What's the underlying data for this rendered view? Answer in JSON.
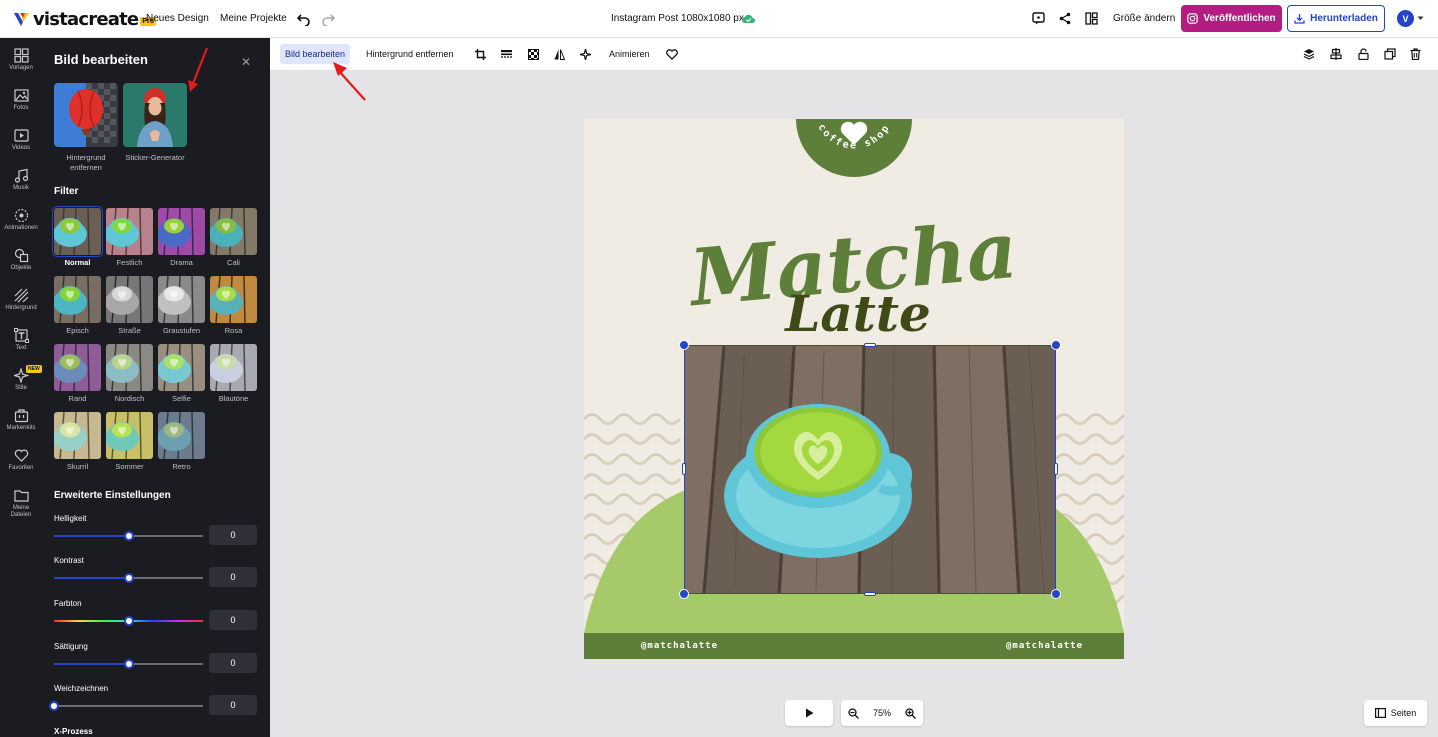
{
  "app": {
    "logo_text": "vistacreate",
    "pro_badge": "Pro",
    "new_design": "Neues Design",
    "my_projects": "Meine Projekte",
    "doc_title": "Instagram Post 1080x1080 px",
    "resize": "Größe ändern",
    "publish": "Veröffentlichen",
    "download": "Herunterladen",
    "avatar_letter": "V",
    "accent": "#2445c5",
    "publish_color": "#b31d82"
  },
  "rail": {
    "items": [
      {
        "label": "Vorlagen",
        "icon": "templates-icon"
      },
      {
        "label": "Fotos",
        "icon": "photos-icon"
      },
      {
        "label": "Videos",
        "icon": "videos-icon"
      },
      {
        "label": "Musik",
        "icon": "music-icon"
      },
      {
        "label": "Animationen",
        "icon": "animations-icon"
      },
      {
        "label": "Objekte",
        "icon": "objects-icon"
      },
      {
        "label": "Hintergrund",
        "icon": "background-icon"
      },
      {
        "label": "Text",
        "icon": "text-icon"
      },
      {
        "label": "Stile",
        "icon": "styles-icon"
      },
      {
        "label": "Markenkits",
        "icon": "brandkits-icon"
      },
      {
        "label": "Favoriten",
        "icon": "favorites-icon"
      },
      {
        "label": "Meine Dateien",
        "icon": "myfiles-icon"
      }
    ],
    "new_badge": "NEW"
  },
  "panel": {
    "title": "Bild bearbeiten",
    "tools": [
      {
        "label": "Hintergrund entfernen"
      },
      {
        "label": "Sticker-Generator"
      }
    ],
    "filter_heading": "Filter",
    "filters": [
      {
        "label": "Normal",
        "selected": true
      },
      {
        "label": "Festlich"
      },
      {
        "label": "Drama"
      },
      {
        "label": "Cali"
      },
      {
        "label": "Episch"
      },
      {
        "label": "Straße"
      },
      {
        "label": "Graustufen"
      },
      {
        "label": "Rosa"
      },
      {
        "label": "Rand"
      },
      {
        "label": "Nordisch"
      },
      {
        "label": "Selfie"
      },
      {
        "label": "Blautöne"
      },
      {
        "label": "Skurril"
      },
      {
        "label": "Sommer"
      },
      {
        "label": "Retro"
      }
    ],
    "advanced_heading": "Erweiterte Einstellungen",
    "sliders": [
      {
        "label": "Helligkeit",
        "value": "0",
        "level": 0.5,
        "track": "blue"
      },
      {
        "label": "Kontrast",
        "value": "0",
        "level": 0.5,
        "track": "blue"
      },
      {
        "label": "Farbton",
        "value": "0",
        "level": 0.5,
        "track": "rainbow"
      },
      {
        "label": "Sättigung",
        "value": "0",
        "level": 0.5,
        "track": "blue"
      },
      {
        "label": "Weichzeichnen",
        "value": "0",
        "level": 0.0,
        "track": "blue"
      }
    ],
    "next_section": "X-Prozess"
  },
  "toolbar": {
    "edit_image": "Bild bearbeiten",
    "remove_bg": "Hintergrund entfernen",
    "animate": "Animieren"
  },
  "design": {
    "badge_text": "coffee shop",
    "title_1": "Matcha",
    "title_2": "Latte",
    "handle_left": "@matchalatte",
    "handle_right": "@matchalatte",
    "green_dark": "#5e7f3a",
    "green_light": "#a6c96a"
  },
  "bottom": {
    "zoom": "75%",
    "pages": "Seiten"
  }
}
